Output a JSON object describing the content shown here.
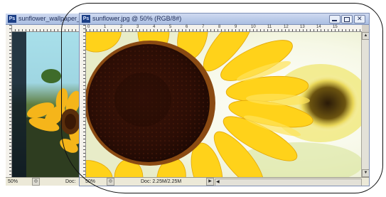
{
  "back_window": {
    "title": "sunflower_wallpaper_",
    "zoom": "50%",
    "doc_label": "Doc:"
  },
  "front_window": {
    "title": "sunflower.jpg @ 50% (RGB/8#)",
    "zoom": "50%",
    "doc_info": "Doc: 2.25M/2.25M"
  },
  "ruler_top_labels": [
    "0",
    "1",
    "2",
    "3",
    "4",
    "5",
    "6",
    "7",
    "8",
    "9",
    "10",
    "11",
    "12",
    "13",
    "14",
    "15"
  ],
  "app_badge": "Ps",
  "colors": {
    "title_text": "#1e2c57",
    "title_bg": "#b9c9ea",
    "petal_yellow": "#ffd21a",
    "seed_center": "#2b0d05",
    "sky": "#9fd6e2"
  }
}
